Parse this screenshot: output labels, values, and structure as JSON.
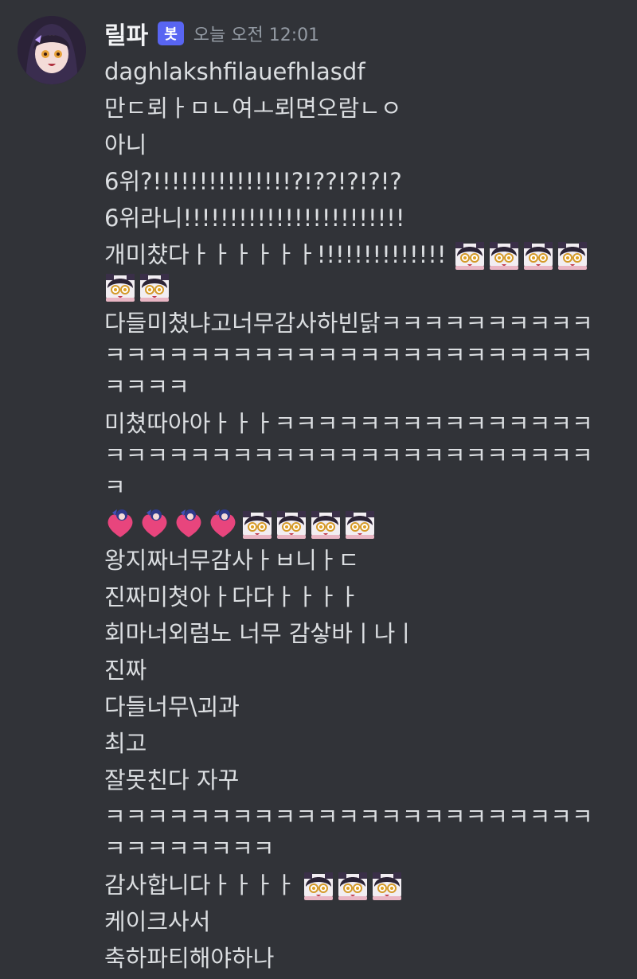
{
  "author": {
    "name": "릴파",
    "badge": "봇",
    "timestamp": "오늘 오전 12:01"
  },
  "messages": [
    {
      "text": "daghlakshfilauefhlasdf"
    },
    {
      "text": "만ㄷ뢰ㅏㅁㄴ여ㅗ뢰면오람ㄴㅇ"
    },
    {
      "text": "아니"
    },
    {
      "text": "6위?!!!!!!!!!!!!!!!?!??!?!?!?"
    },
    {
      "text": "6위라니!!!!!!!!!!!!!!!!!!!!!!!!"
    },
    {
      "text": "개미챴다ㅏㅏㅏㅏㅏㅏ!!!!!!!!!!!!!!",
      "emojis": [
        "girl-face-emoji",
        "girl-face-emoji",
        "girl-face-emoji",
        "girl-face-emoji",
        "girl-face-emoji",
        "girl-face-emoji"
      ]
    },
    {
      "text": "다들미쳤냐고너무감사하빈닭ㅋㅋㅋㅋㅋㅋㅋㅋㅋㅋㅋㅋㅋㅋㅋㅋㅋㅋㅋㅋㅋㅋㅋㅋㅋㅋㅋㅋㅋㅋㅋㅋㅋㅋㅋㅋㅋ"
    },
    {
      "text": "미쳤따아아ㅏㅏㅏㅋㅋㅋㅋㅋㅋㅋㅋㅋㅋㅋㅋㅋㅋㅋㅋㅋㅋㅋㅋㅋㅋㅋㅋㅋㅋㅋㅋㅋㅋㅋㅋㅋㅋㅋㅋㅋㅋㅋ"
    },
    {
      "text": "",
      "emojis": [
        "heart-emoji",
        "heart-emoji",
        "heart-emoji",
        "heart-emoji",
        "girl-face-emoji",
        "girl-face-emoji",
        "girl-face-emoji",
        "girl-face-emoji"
      ]
    },
    {
      "text": "왕지짜너무감사ㅏㅂ니ㅏㄷ"
    },
    {
      "text": "진짜미쳣아ㅏ다다ㅏㅏㅏㅏ"
    },
    {
      "text": "회마너외럼노 너무 감샇바ㅣ나ㅣ"
    },
    {
      "text": "진짜"
    },
    {
      "text": "다들너무\\괴과"
    },
    {
      "text": "최고"
    },
    {
      "text": "잘못친다 자꾸"
    },
    {
      "text": "ㅋㅋㅋㅋㅋㅋㅋㅋㅋㅋㅋㅋㅋㅋㅋㅋㅋㅋㅋㅋㅋㅋㅋㅋㅋㅋㅋㅋㅋㅋㅋ"
    },
    {
      "text": "감사합니다ㅏㅏㅏㅏ",
      "emojis": [
        "girl-face-emoji",
        "girl-face-emoji",
        "girl-face-emoji"
      ]
    },
    {
      "text": "케이크사서"
    },
    {
      "text": "축하파티해야하나"
    }
  ]
}
